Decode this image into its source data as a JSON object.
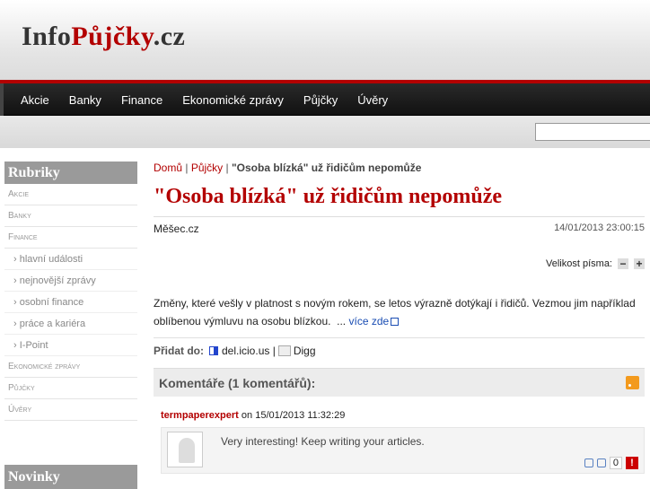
{
  "logo": {
    "part1": "Info",
    "part2": "Půjčky",
    "part3": ".cz"
  },
  "nav": {
    "items": [
      "Akcie",
      "Banky",
      "Finance",
      "Ekonomické zprávy",
      "Půjčky",
      "Úvěry"
    ]
  },
  "search": {
    "placeholder": ""
  },
  "sidebar": {
    "heading": "Rubriky",
    "items": {
      "akcie": "Akcie",
      "banky": "Banky",
      "finance": "Finance",
      "sub": [
        "› hlavní události",
        "› nejnovější zprávy",
        "› osobní finance",
        "› práce a kariéra",
        "› I-Point"
      ],
      "ekonomicke": "Ekonomické zprávy",
      "pujcky": "Půjčky",
      "uvery": "Úvěry"
    },
    "heading2": "Novinky"
  },
  "breadcrumb": {
    "home": "Domů",
    "sep1": " |",
    "section": "Půjčky",
    "sep2": " |",
    "current": "\"Osoba blízká\" už řidičům nepomůže"
  },
  "article": {
    "title": "\"Osoba blízká\" už řidičům nepomůže",
    "source": "Měšec.cz",
    "date": "14/01/2013 23:00:15",
    "font_size_label": "Velikost písma:",
    "font_minus": "−",
    "font_plus": "+",
    "body": "Změny, které vešly v platnost s novým rokem, se letos výrazně dotýkají i řidičů. Vezmou jim například oblíbenou výmluvu na osobu blízkou.",
    "more_prefix": "...",
    "more_label": "více zde"
  },
  "share": {
    "label": "Přidat do:",
    "delicious": "del.icio.us",
    "separator": "|",
    "digg": "Digg"
  },
  "comments": {
    "heading": "Komentáře (1 komentářů):",
    "items": [
      {
        "author": "termpaperexpert",
        "on": "on",
        "date": "15/01/2013 11:32:29",
        "text": "Very interesting! Keep writing your articles.",
        "votes": "0",
        "report": "!"
      }
    ]
  }
}
